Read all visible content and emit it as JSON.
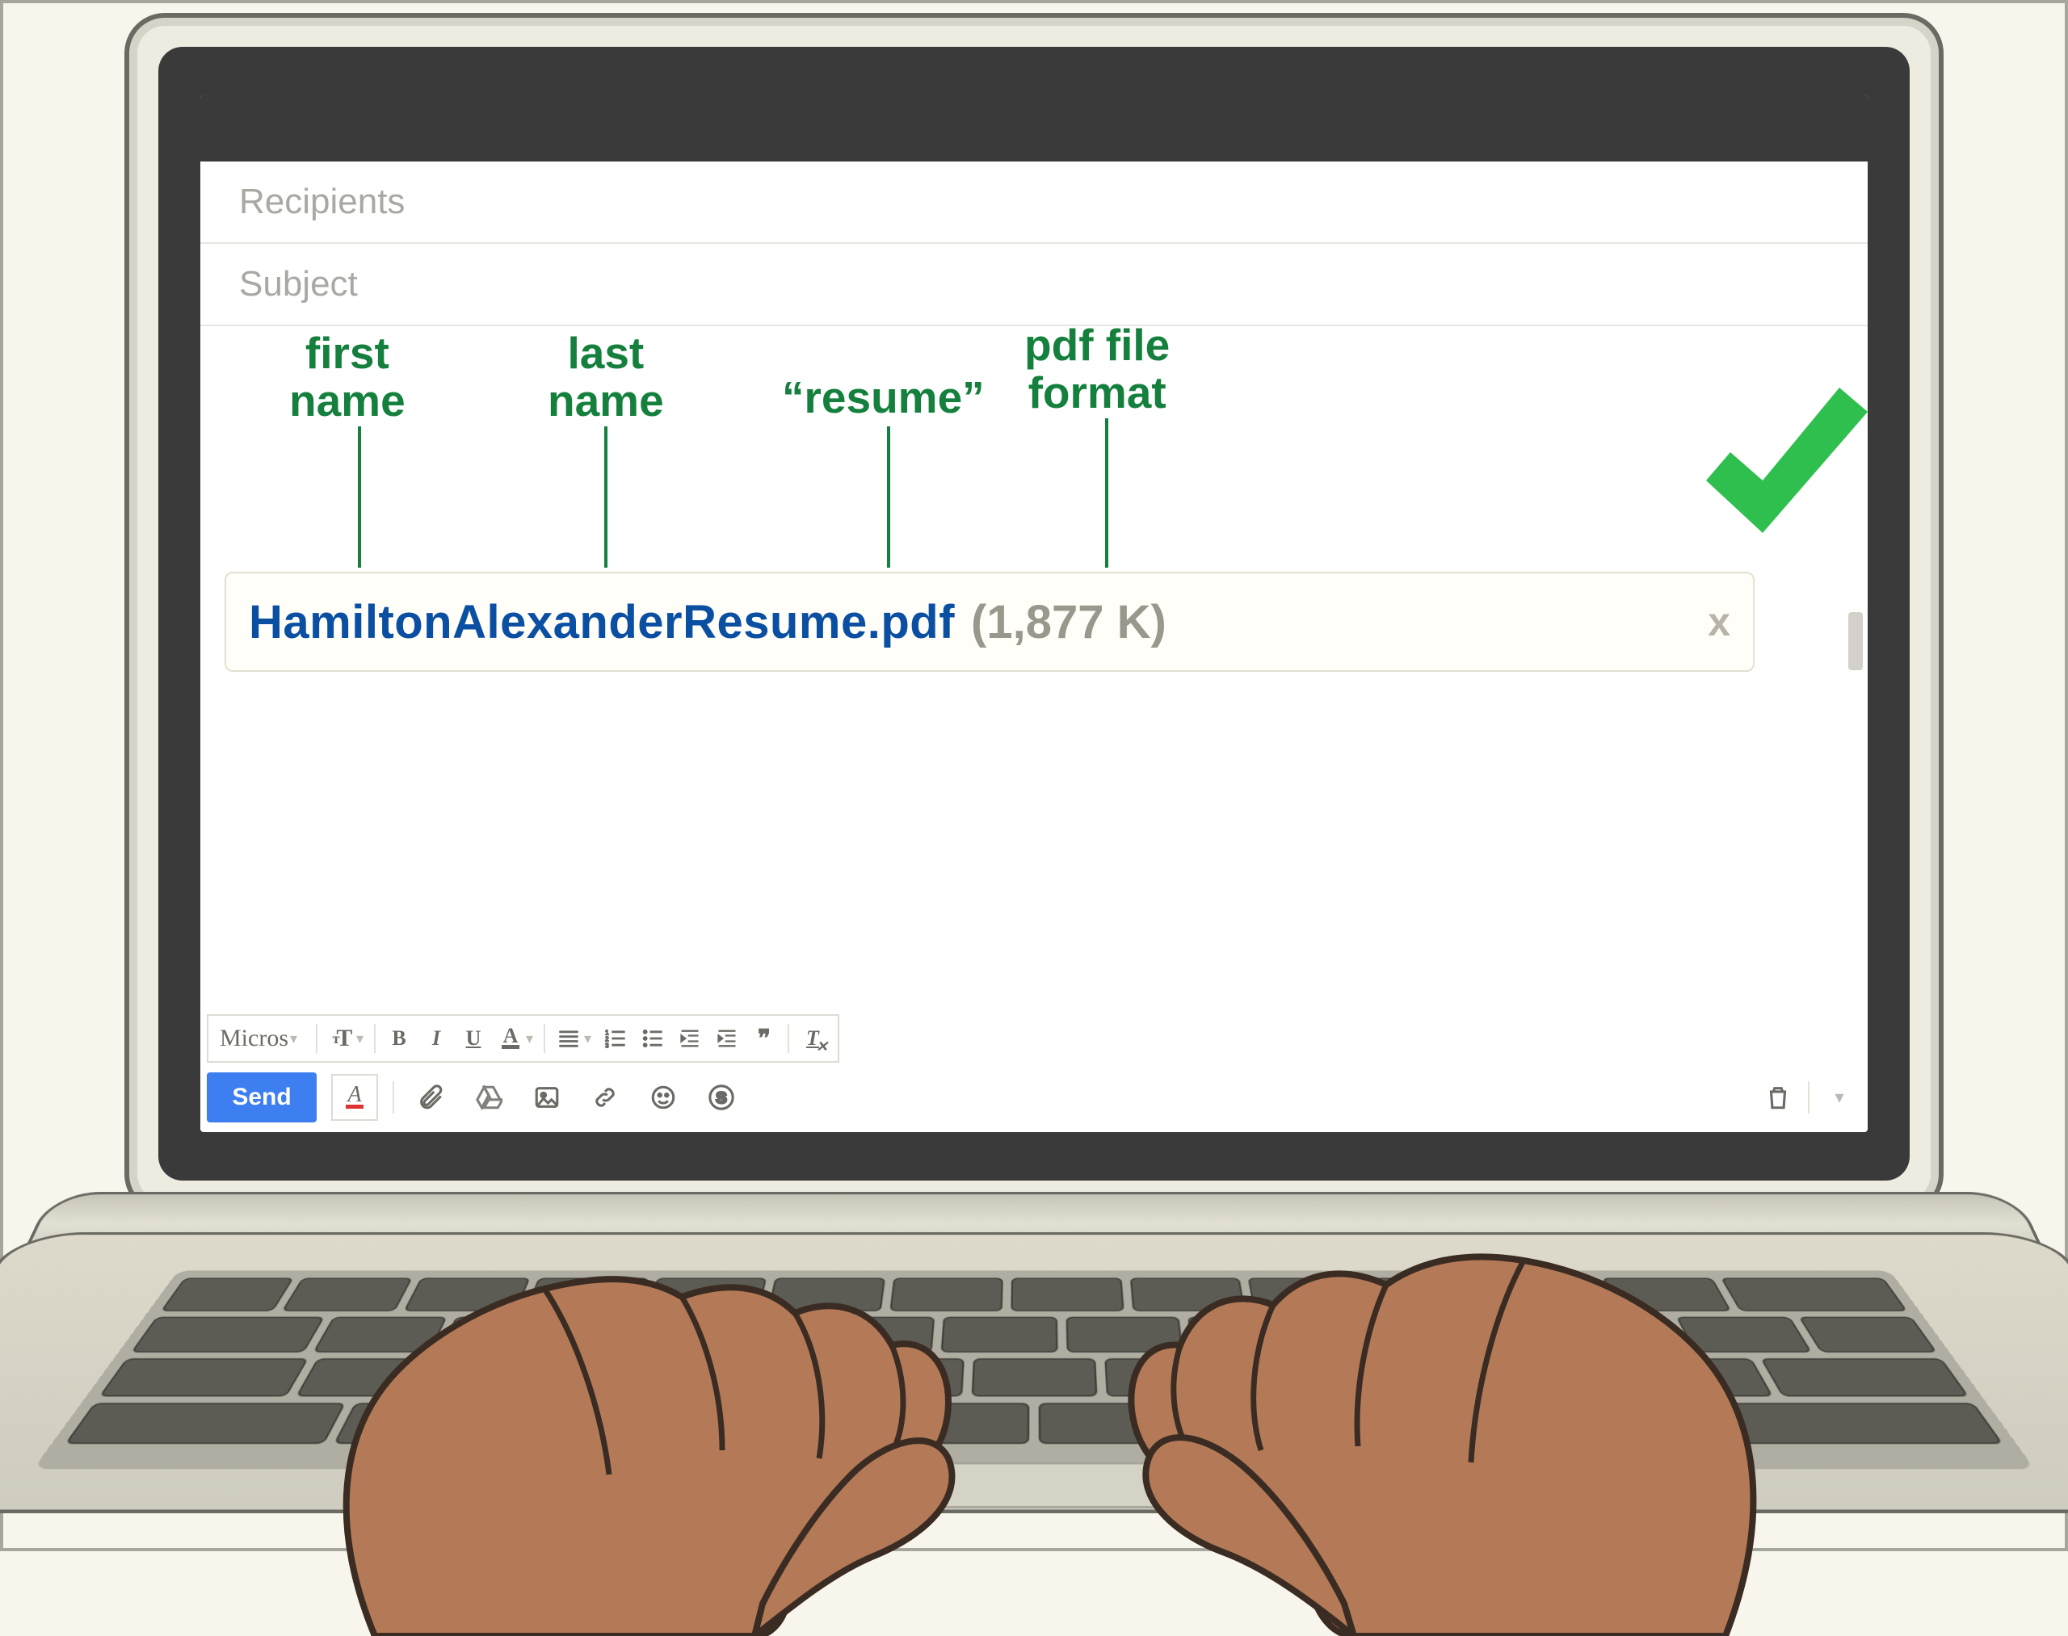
{
  "compose": {
    "recipients_placeholder": "Recipients",
    "subject_placeholder": "Subject",
    "font_name": "Micros",
    "send_label": "Send"
  },
  "attachment": {
    "filename": "HamiltonAlexanderResume.pdf",
    "size_display": "(1,877 K)",
    "close_glyph": "x"
  },
  "annotations": {
    "first_name": "first\nname",
    "last_name": "last\nname",
    "resume": "“resume”",
    "format": "pdf file\nformat"
  },
  "toolbar": {
    "size_glyph": "тT",
    "bold": "B",
    "italic": "I",
    "underline": "U",
    "textcolor": "A",
    "quote": "❞❞"
  },
  "colors": {
    "accent_green": "#15803d",
    "link_blue": "#0b4fa3",
    "send_blue": "#3d7ff0",
    "check_green": "#2fbf4f"
  }
}
